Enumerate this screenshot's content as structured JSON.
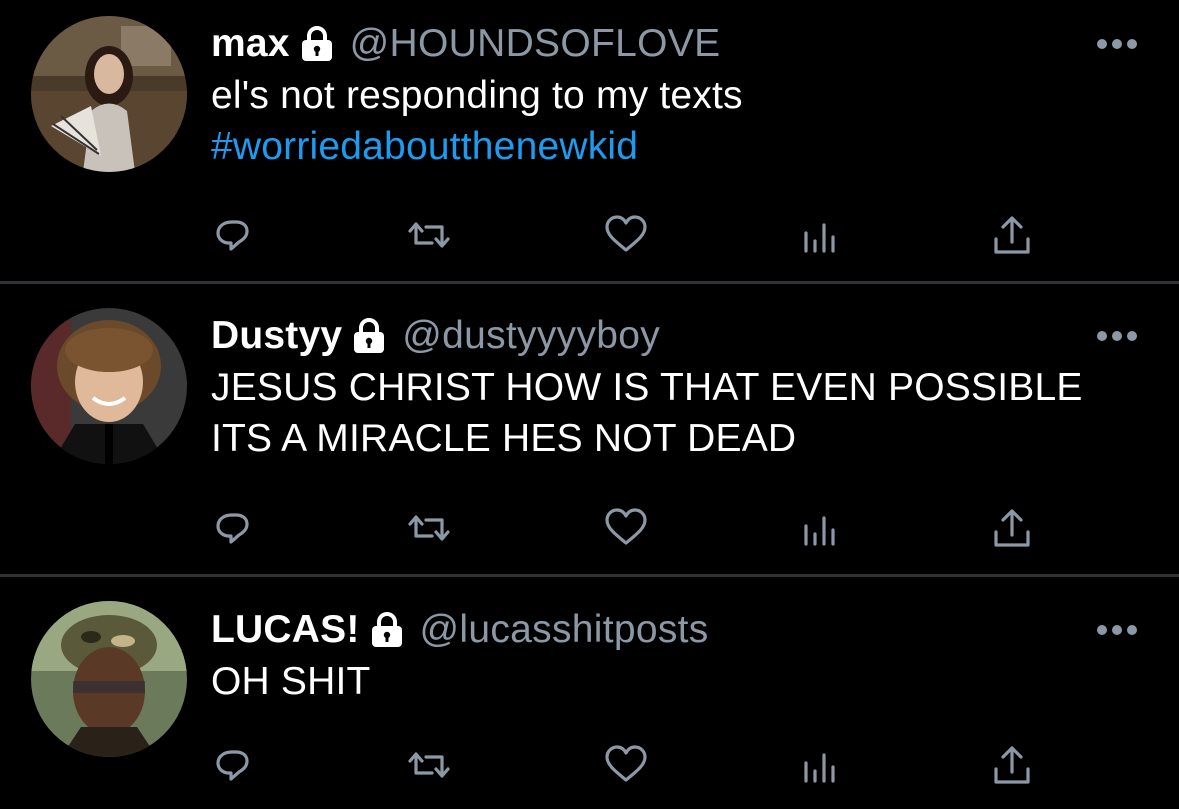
{
  "theme": {
    "background": "#000000",
    "text": "#ffffff",
    "muted": "#8b98a5",
    "link": "#1d9bf0",
    "divider": "#2f3336"
  },
  "tweets": [
    {
      "name": "max",
      "handle": "@HOUNDSOFLOVE",
      "line1": "el's not responding to my texts",
      "hashtag": "#worriedaboutthenewkid",
      "avatar_icon": "avatar-max",
      "lock_icon": "lock-icon"
    },
    {
      "name": "Dustyy",
      "handle": "@dustyyyyboy",
      "line1": "JESUS CHRIST HOW IS THAT EVEN POSSIBLE",
      "line2": "ITS A MIRACLE HES NOT DEAD",
      "avatar_icon": "avatar-dustyy",
      "lock_icon": "lock-icon"
    },
    {
      "name": "LUCAS!",
      "handle": "@lucasshitposts",
      "line1": "OH SHIT",
      "avatar_icon": "avatar-lucas",
      "lock_icon": "lock-icon"
    }
  ],
  "action_icons": [
    "reply-icon",
    "retweet-icon",
    "like-icon",
    "analytics-icon",
    "share-icon"
  ]
}
